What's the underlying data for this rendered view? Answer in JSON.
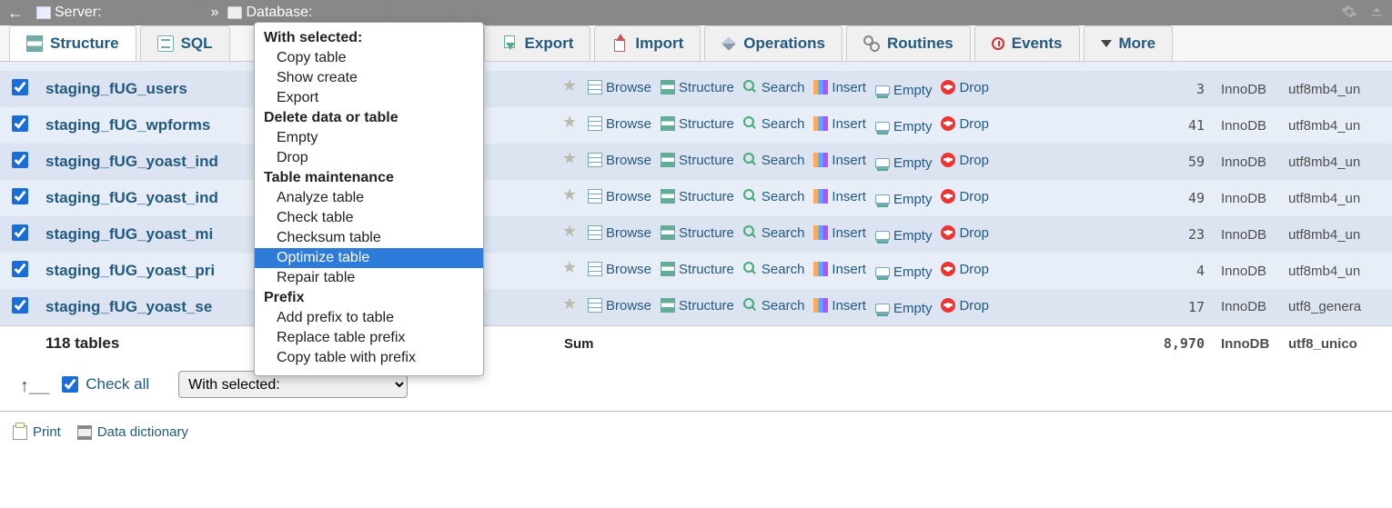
{
  "breadcrumb": {
    "server_label": "Server:",
    "database_label": "Database:"
  },
  "tabs": {
    "structure": "Structure",
    "sql": "SQL",
    "export": "Export",
    "import": "Import",
    "operations": "Operations",
    "routines": "Routines",
    "events": "Events",
    "more": "More"
  },
  "actions": {
    "browse": "Browse",
    "structure": "Structure",
    "search": "Search",
    "insert": "Insert",
    "empty": "Empty",
    "drop": "Drop"
  },
  "tables": [
    {
      "name": "staging_fUG_users",
      "rows": "3",
      "engine": "InnoDB",
      "collation": "utf8mb4_un"
    },
    {
      "name": "staging_fUG_wpforms",
      "rows": "41",
      "engine": "InnoDB",
      "collation": "utf8mb4_un"
    },
    {
      "name": "staging_fUG_yoast_ind",
      "rows": "59",
      "engine": "InnoDB",
      "collation": "utf8mb4_un"
    },
    {
      "name": "staging_fUG_yoast_ind",
      "rows": "49",
      "engine": "InnoDB",
      "collation": "utf8mb4_un"
    },
    {
      "name": "staging_fUG_yoast_mi",
      "rows": "23",
      "engine": "InnoDB",
      "collation": "utf8mb4_un"
    },
    {
      "name": "staging_fUG_yoast_pri",
      "rows": "4",
      "engine": "InnoDB",
      "collation": "utf8mb4_un"
    },
    {
      "name": "staging_fUG_yoast_se",
      "rows": "17",
      "engine": "InnoDB",
      "collation": "utf8_genera"
    }
  ],
  "summary": {
    "count_label": "118 tables",
    "sum_label": "Sum",
    "rows": "8,970",
    "engine": "InnoDB",
    "collation": "utf8_unico"
  },
  "footer": {
    "check_all": "Check all",
    "with_selected": "With selected:"
  },
  "links": {
    "print": "Print",
    "data_dictionary": "Data dictionary"
  },
  "context_menu": {
    "with_selected": "With selected:",
    "copy_table": "Copy table",
    "show_create": "Show create",
    "export": "Export",
    "delete_hdr": "Delete data or table",
    "empty": "Empty",
    "drop": "Drop",
    "maint_hdr": "Table maintenance",
    "analyze": "Analyze table",
    "check": "Check table",
    "checksum": "Checksum table",
    "optimize": "Optimize table",
    "repair": "Repair table",
    "prefix_hdr": "Prefix",
    "add_prefix": "Add prefix to table",
    "replace_prefix": "Replace table prefix",
    "copy_prefix": "Copy table with prefix"
  }
}
